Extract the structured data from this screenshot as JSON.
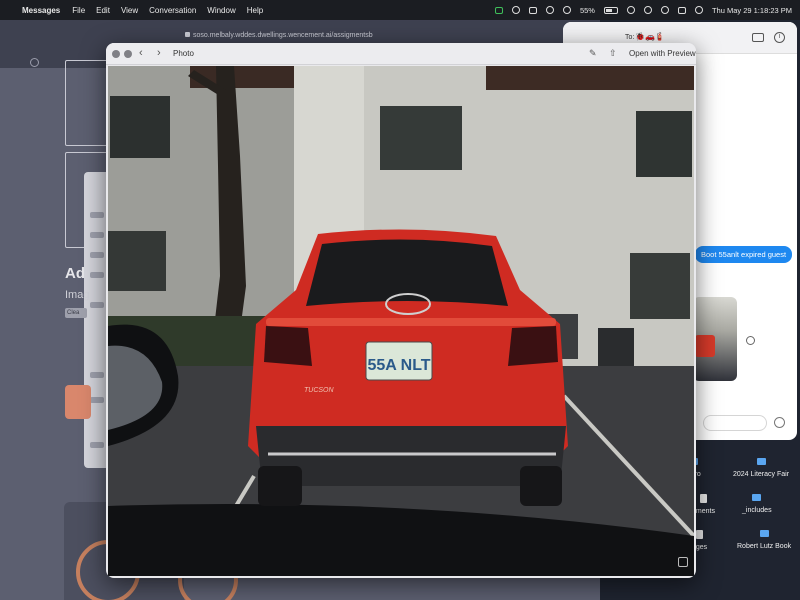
{
  "menubar": {
    "app": "Messages",
    "menus": [
      "File",
      "Edit",
      "View",
      "Conversation",
      "Window",
      "Help"
    ],
    "battery": "55%",
    "clock": "Thu May 29  1:18:23 PM"
  },
  "browser": {
    "url": "soso.melbaly.wddes.dwellings.wencement.ai/assigmentsb",
    "heading": "Ad",
    "subheading": "Imag",
    "pill": "Clea"
  },
  "messages": {
    "to_label": "To:",
    "bubble_text": "Boot 55anlt expired guest"
  },
  "desktop": {
    "icons": [
      {
        "name": "folder-icon",
        "label": "Euro"
      },
      {
        "name": "folder-icon",
        "label": "2024 Literacy Fair"
      },
      {
        "name": "doc-icon",
        "label": "uments"
      },
      {
        "name": "folder-icon",
        "label": "_includes"
      },
      {
        "name": "doc-icon",
        "label": "ages"
      },
      {
        "name": "folder-icon",
        "label": "Robert Lutz Book"
      }
    ]
  },
  "photo_window": {
    "title": "Photo",
    "open_with": "Open with Preview",
    "plate_text": "55A NLT",
    "badge_text": "TUCSON"
  }
}
